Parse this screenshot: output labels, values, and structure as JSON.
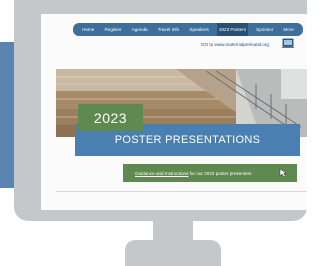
{
  "nav": {
    "items": [
      {
        "label": "Home"
      },
      {
        "label": "Register"
      },
      {
        "label": "Agenda"
      },
      {
        "label": "Travel Info"
      },
      {
        "label": "Speakers"
      },
      {
        "label": "2023 Posters"
      },
      {
        "label": "Sponsor"
      },
      {
        "label": "More"
      }
    ],
    "active_index": 5
  },
  "goto": {
    "prefix": "GO to",
    "url": "www.maternalperinatal.org"
  },
  "hero": {
    "year": "2023",
    "title": "POSTER PRESENTATIONS"
  },
  "guidance": {
    "link_text": "Guidance and Instructions",
    "rest_text": " for our 2023 poster presenters"
  },
  "icons": {
    "laptop": "laptop-icon",
    "cursor": "cursor-arrow-icon"
  },
  "colors": {
    "nav": "#3e6f9a",
    "title_band": "#4a7fb1",
    "green": "#5f8a4f",
    "frame": "#c5c8ca",
    "side_band": "#5b84b1"
  }
}
